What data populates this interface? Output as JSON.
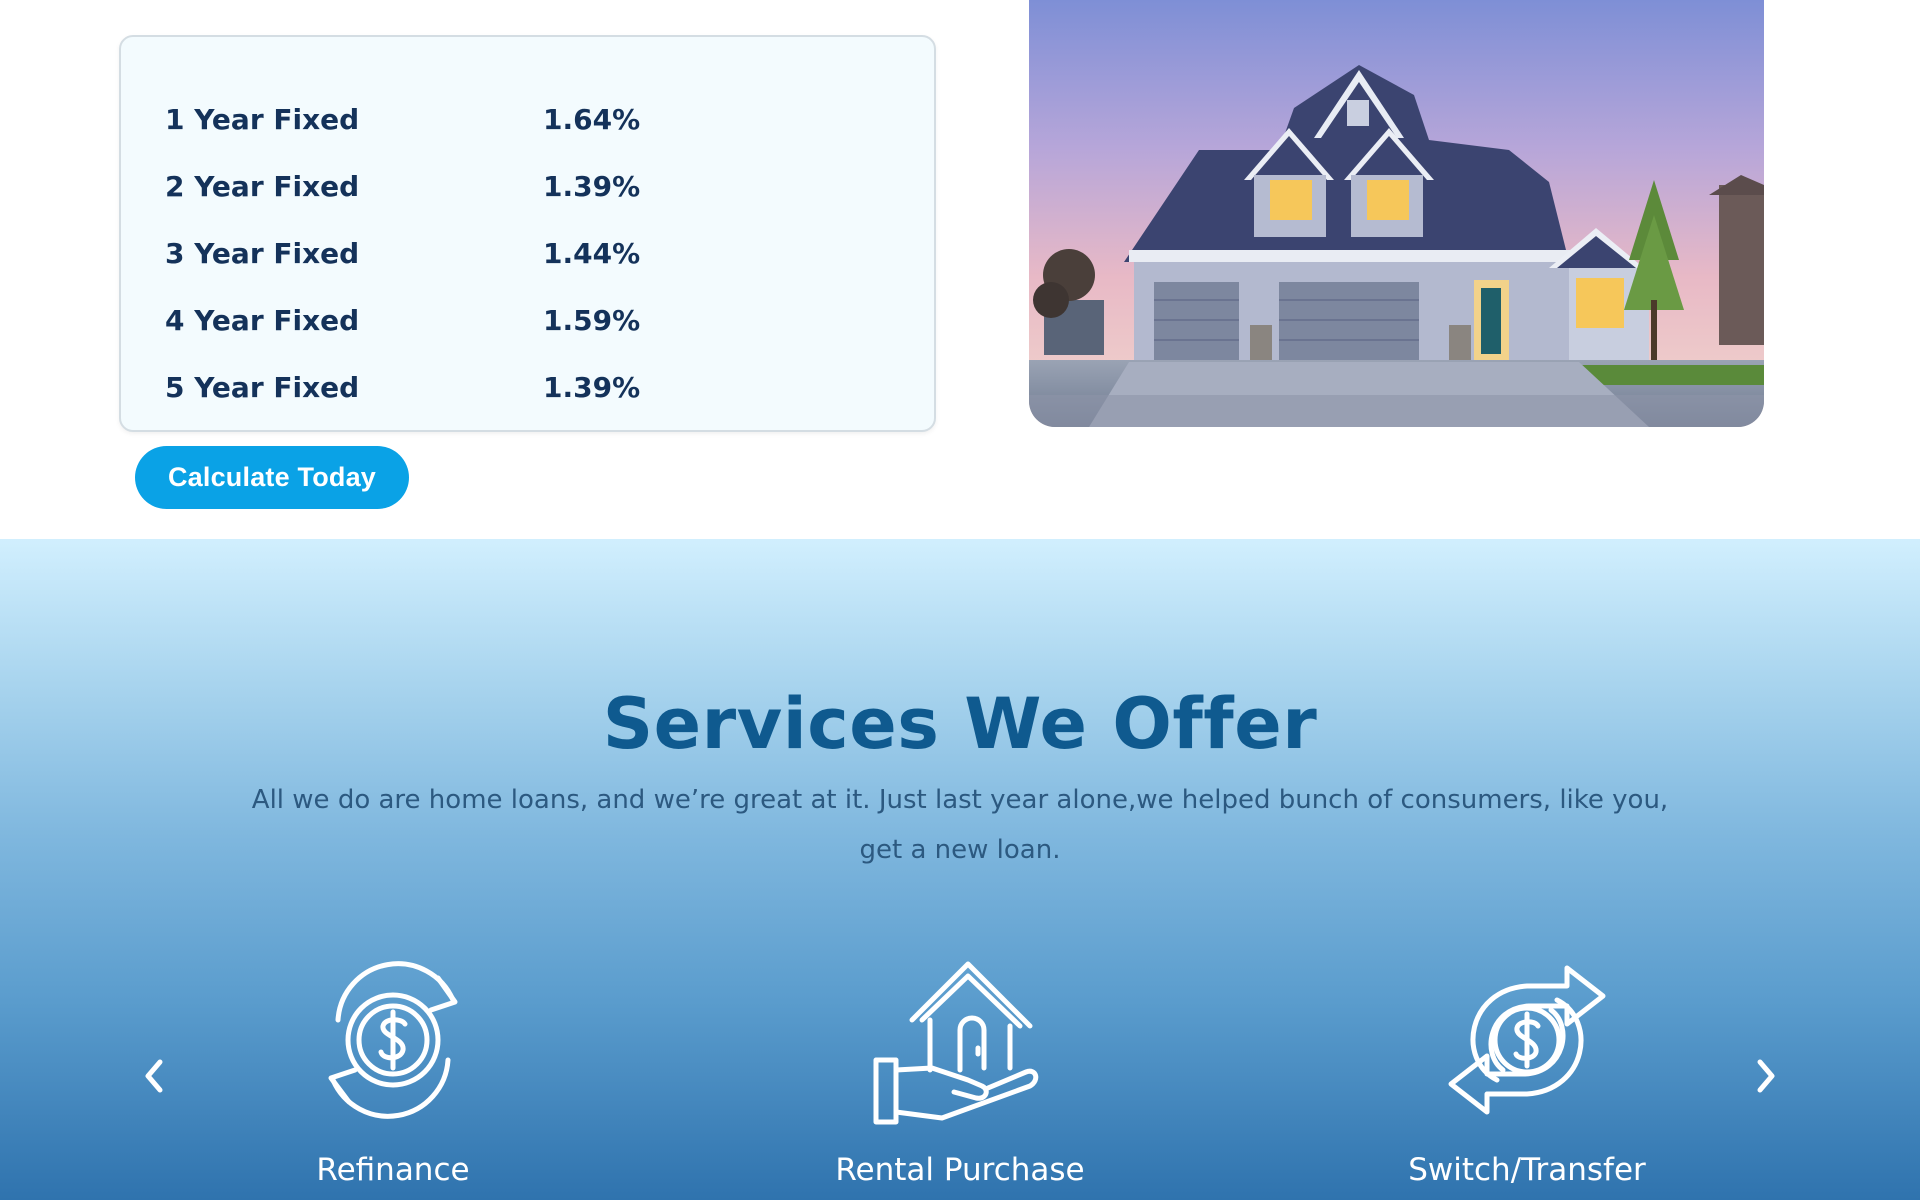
{
  "rates": [
    {
      "term": "1 Year Fixed",
      "rate": "1.64%"
    },
    {
      "term": "2 Year Fixed",
      "rate": "1.39%"
    },
    {
      "term": "3 Year Fixed",
      "rate": "1.44%"
    },
    {
      "term": "4 Year Fixed",
      "rate": "1.59%"
    },
    {
      "term": "5 Year Fixed",
      "rate": "1.39%"
    }
  ],
  "cta": {
    "label": "Calculate Today"
  },
  "services": {
    "title": "Services We Offer",
    "description": "All we do are home loans, and we’re great at it. Just last year alone,we  helped bunch of consumers, like you, get a new loan.",
    "items": [
      {
        "label": "Refinance",
        "icon": "refinance-dollar-cycle-icon"
      },
      {
        "label": "Rental Purchase",
        "icon": "house-in-hand-icon"
      },
      {
        "label": "Switch/Transfer",
        "icon": "dollar-transfer-arrows-icon"
      }
    ]
  },
  "colors": {
    "accent": "#0aa2e6",
    "heading": "#0f5a8f",
    "rate_text": "#14325a"
  }
}
